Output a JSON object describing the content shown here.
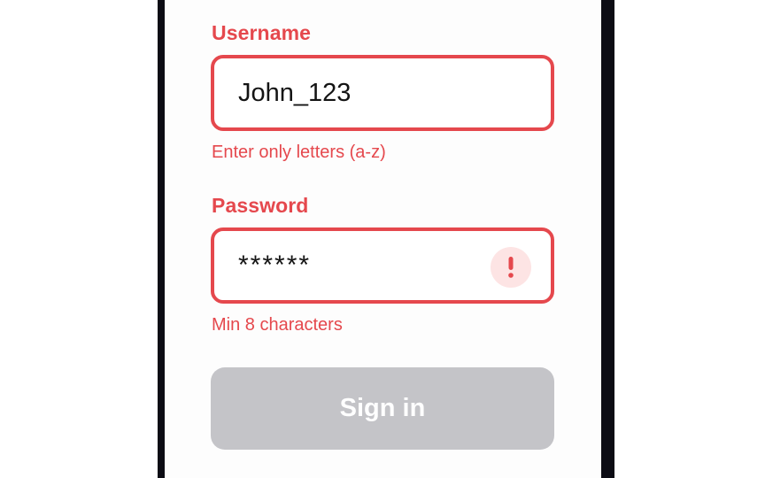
{
  "form": {
    "username": {
      "label": "Username",
      "value": "John_123",
      "error": "Enter only letters (a-z)"
    },
    "password": {
      "label": "Password",
      "value": "******",
      "error": "Min 8 characters",
      "icon": "error-exclamation-icon"
    },
    "submit_label": "Sign in",
    "submit_enabled": false
  },
  "colors": {
    "error": "#e5484d",
    "error_badge_bg": "#fde4e4",
    "disabled_button": "#c4c4c8",
    "bezel": "#0c0c14"
  }
}
